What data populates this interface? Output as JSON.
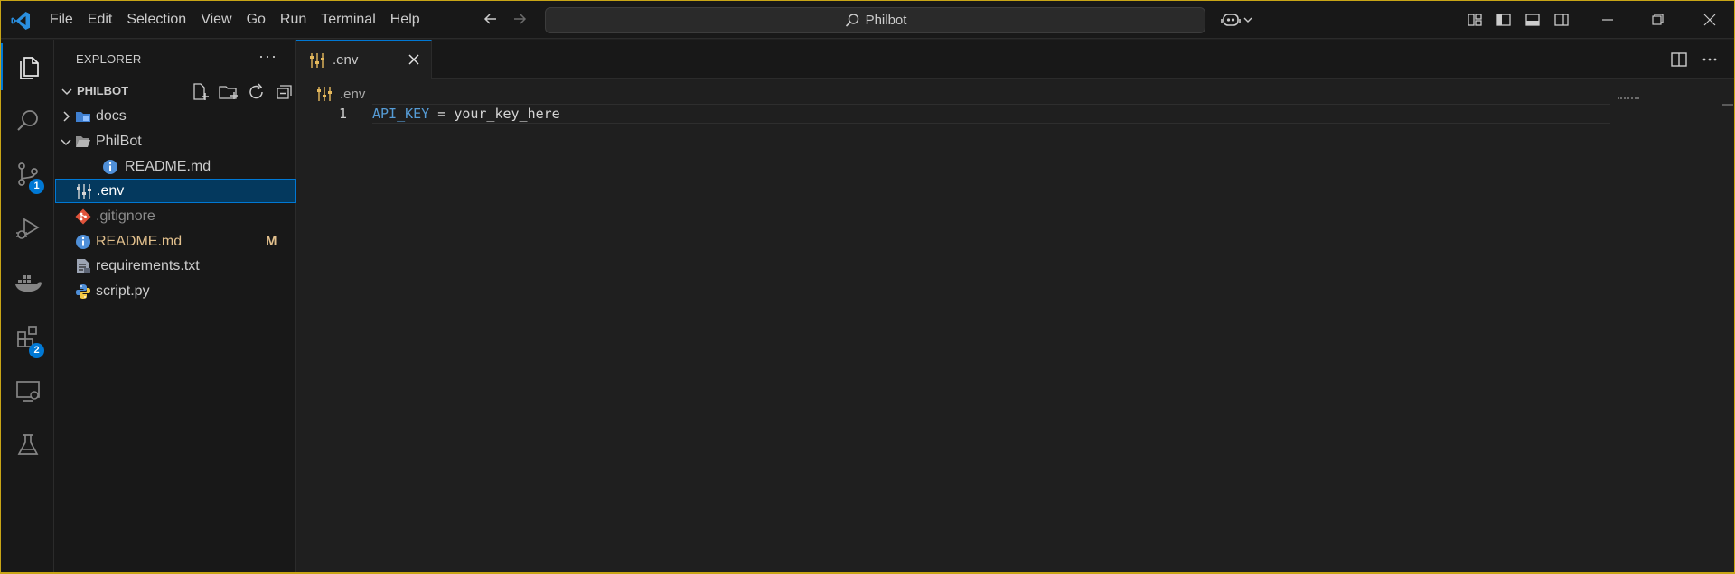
{
  "window": {
    "title": "Philbot"
  },
  "menu": [
    "File",
    "Edit",
    "Selection",
    "View",
    "Go",
    "Run",
    "Terminal",
    "Help"
  ],
  "activity": {
    "source_control_badge": "1",
    "extensions_badge": "2"
  },
  "sidebar": {
    "header": "EXPLORER",
    "more": "···",
    "section_title": "PHILBOT",
    "tree": [
      {
        "label": "docs",
        "type": "folder",
        "expanded": false
      },
      {
        "label": "PhilBot",
        "type": "folder",
        "expanded": true
      },
      {
        "label": "README.md",
        "type": "file",
        "icon": "info-icon"
      },
      {
        "label": ".env",
        "type": "file",
        "icon": "env-settings-icon",
        "selected": true
      },
      {
        "label": ".gitignore",
        "type": "file",
        "icon": "git-icon"
      },
      {
        "label": "README.md",
        "type": "file",
        "icon": "info-icon",
        "status": "M"
      },
      {
        "label": "requirements.txt",
        "type": "file",
        "icon": "text-file-icon"
      },
      {
        "label": "script.py",
        "type": "file",
        "icon": "python-icon"
      }
    ]
  },
  "editor": {
    "tab_label": ".env",
    "breadcrumb": ".env",
    "line_number": "1",
    "code_key": "API_KEY",
    "code_op": " = ",
    "code_value": "your_key_here"
  },
  "colors": {
    "accent": "#0078d4",
    "modified": "#e2c08d",
    "env_key": "#569cd6"
  }
}
